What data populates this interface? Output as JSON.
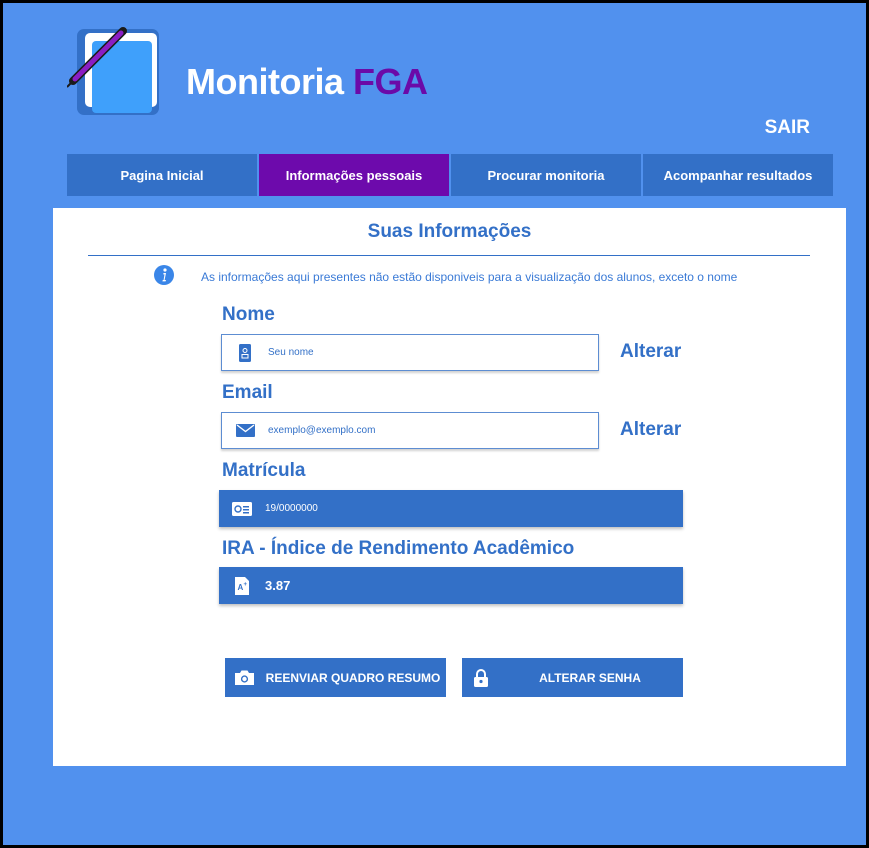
{
  "app": {
    "title_main": "Monitoria",
    "title_accent": "FGA",
    "logout_label": "SAIR"
  },
  "nav": {
    "items": [
      {
        "label": "Pagina Inicial",
        "active": false
      },
      {
        "label": "Informações pessoais",
        "active": true
      },
      {
        "label": "Procurar monitoria",
        "active": false
      },
      {
        "label": "Acompanhar resultados",
        "active": false
      }
    ]
  },
  "card": {
    "title": "Suas Informações",
    "notice": "As informações aqui presentes não estão disponiveis para a visualização dos alunos, exceto o nome"
  },
  "fields": {
    "nome": {
      "label": "Nome",
      "placeholder": "Seu nome",
      "action": "Alterar",
      "icon": "id-badge-icon"
    },
    "email": {
      "label": "Email",
      "placeholder": "exemplo@exemplo.com",
      "action": "Alterar",
      "icon": "envelope-icon"
    },
    "matricula": {
      "label": "Matrícula",
      "value": "19/0000000",
      "icon": "id-card-icon"
    },
    "ira": {
      "label": "IRA - Índice de Rendimento Acadêmico",
      "value": "3.87",
      "icon": "grade-document-icon"
    }
  },
  "actions": {
    "resend_label": "REENVIAR QUADRO RESUMO",
    "resend_icon": "camera-icon",
    "password_label": "ALTERAR SENHA",
    "password_icon": "lock-icon"
  },
  "colors": {
    "background": "#5191ee",
    "primary": "#3370c7",
    "accent": "#6d0aac",
    "card": "#ffffff"
  }
}
